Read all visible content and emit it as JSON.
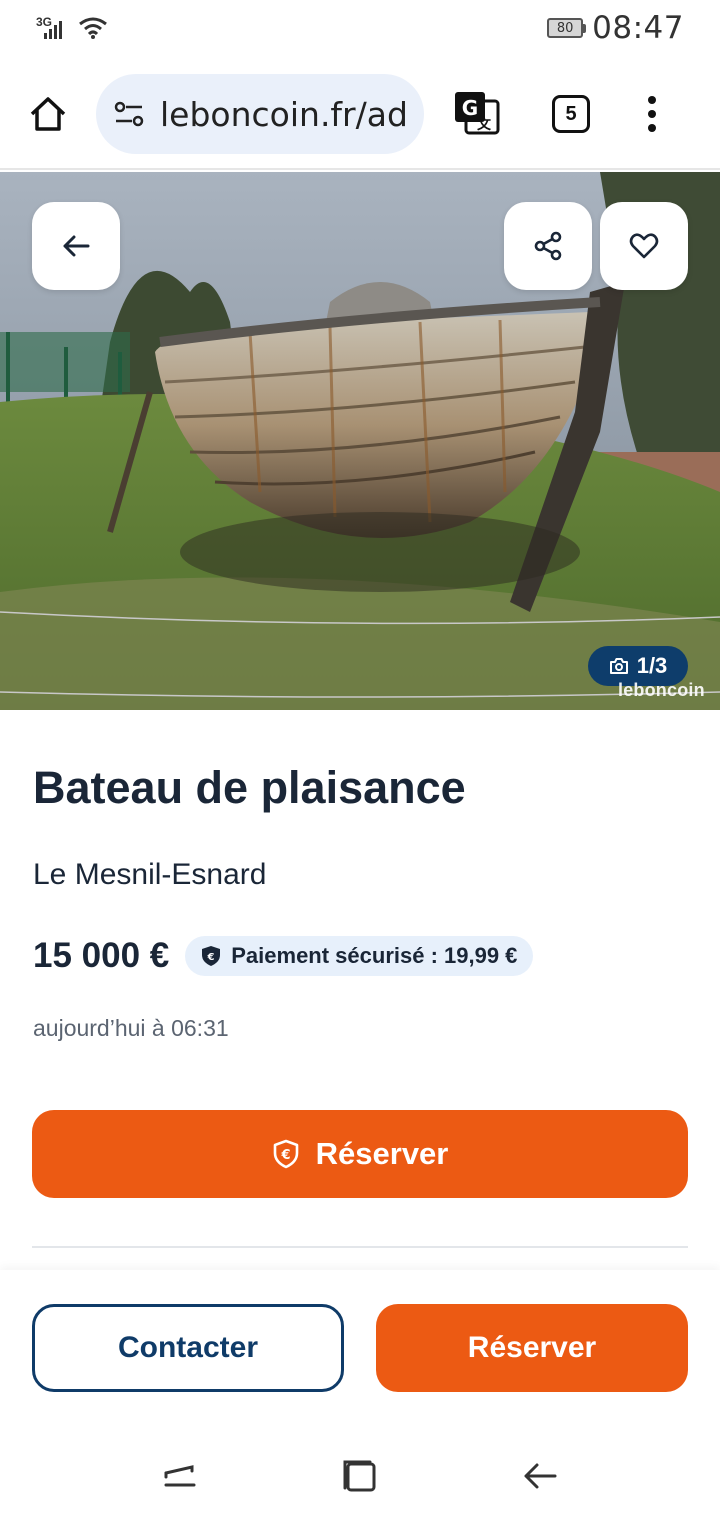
{
  "status_bar": {
    "network": "3G",
    "battery": "80",
    "time": "08:47"
  },
  "browser": {
    "url": "leboncoin.fr/ad",
    "tab_count": "5",
    "icons": [
      "home-icon",
      "site-settings-icon",
      "translate-icon",
      "tabs-icon",
      "more-vert-icon"
    ]
  },
  "gallery": {
    "counter": "1/3",
    "watermark": "leboncoin",
    "icons": [
      "back-arrow-icon",
      "share-icon",
      "heart-icon",
      "camera-icon"
    ]
  },
  "listing": {
    "title": "Bateau de plaisance",
    "location": "Le Mesnil-Esnard",
    "price": "15 000 €",
    "secure_payment": "Paiement sécurisé : 19,99 €",
    "date": "aujourd’hui à 06:31",
    "reserve_label": "Réserver"
  },
  "bottom_actions": {
    "contact_label": "Contacter",
    "reserve_label": "Réserver"
  },
  "colors": {
    "accent_orange": "#ec5a13",
    "brand_blue": "#0f3b68",
    "badge_bg": "#e7f0fb",
    "text_dark": "#1a2637"
  },
  "system_nav": [
    "recents-icon",
    "home-square-icon",
    "back-icon"
  ]
}
